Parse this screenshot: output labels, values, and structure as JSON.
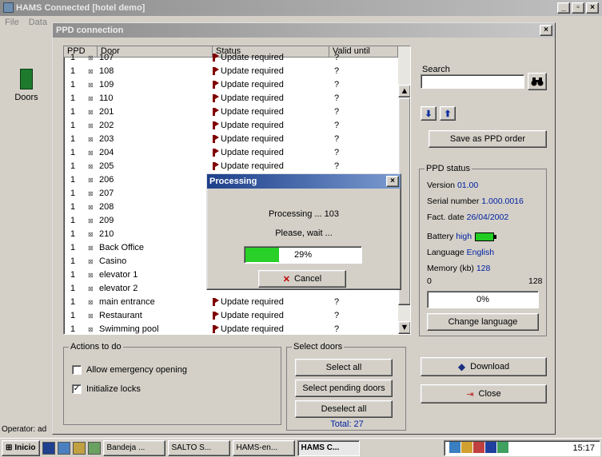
{
  "app": {
    "title": "HAMS Connected [hotel demo]",
    "menu": [
      "File",
      "Data"
    ],
    "left_tool_label": "Doors",
    "operator": "Operator: ad"
  },
  "dialog": {
    "title": "PPD connection",
    "close": "×"
  },
  "table": {
    "headers": [
      "PPD",
      "Door",
      "Status",
      "Valid until"
    ],
    "rows": [
      {
        "ppd": "1",
        "door": "107",
        "status": "Update required",
        "valid": "?"
      },
      {
        "ppd": "1",
        "door": "108",
        "status": "Update required",
        "valid": "?"
      },
      {
        "ppd": "1",
        "door": "109",
        "status": "Update required",
        "valid": "?"
      },
      {
        "ppd": "1",
        "door": "110",
        "status": "Update required",
        "valid": "?"
      },
      {
        "ppd": "1",
        "door": "201",
        "status": "Update required",
        "valid": "?"
      },
      {
        "ppd": "1",
        "door": "202",
        "status": "Update required",
        "valid": "?"
      },
      {
        "ppd": "1",
        "door": "203",
        "status": "Update required",
        "valid": "?"
      },
      {
        "ppd": "1",
        "door": "204",
        "status": "Update required",
        "valid": "?"
      },
      {
        "ppd": "1",
        "door": "205",
        "status": "Update required",
        "valid": "?"
      },
      {
        "ppd": "1",
        "door": "206",
        "status": "",
        "valid": ""
      },
      {
        "ppd": "1",
        "door": "207",
        "status": "",
        "valid": ""
      },
      {
        "ppd": "1",
        "door": "208",
        "status": "",
        "valid": ""
      },
      {
        "ppd": "1",
        "door": "209",
        "status": "",
        "valid": ""
      },
      {
        "ppd": "1",
        "door": "210",
        "status": "",
        "valid": ""
      },
      {
        "ppd": "1",
        "door": "Back Office",
        "status": "",
        "valid": ""
      },
      {
        "ppd": "1",
        "door": "Casino",
        "status": "",
        "valid": ""
      },
      {
        "ppd": "1",
        "door": "elevator 1",
        "status": "",
        "valid": ""
      },
      {
        "ppd": "1",
        "door": "elevator 2",
        "status": "",
        "valid": ""
      },
      {
        "ppd": "1",
        "door": "main entrance",
        "status": "Update required",
        "valid": "?"
      },
      {
        "ppd": "1",
        "door": "Restaurant",
        "status": "Update required",
        "valid": "?"
      },
      {
        "ppd": "1",
        "door": "Swimming pool",
        "status": "Update required",
        "valid": "?"
      }
    ]
  },
  "search": {
    "label": "Search",
    "value": "",
    "button_icon": "binoculars-icon"
  },
  "save_order_label": "Save as PPD order",
  "ppd_status": {
    "title": "PPD status",
    "version_label": "Version",
    "version": "01.00",
    "serial_label": "Serial number",
    "serial": "1.000.0016",
    "fact_label": "Fact. date",
    "fact_date": "26/04/2002",
    "battery_label": "Battery",
    "battery": "high",
    "language_label": "Language",
    "language": "English",
    "memory_label": "Memory (kb)",
    "memory": "128",
    "scale_min": "0",
    "scale_max": "128",
    "memory_used": "0%",
    "change_language_label": "Change language"
  },
  "actions": {
    "title": "Actions to do",
    "allow_emergency": "Allow emergency opening",
    "allow_emergency_checked": false,
    "initialize_locks": "Initialize locks",
    "initialize_locks_checked": true
  },
  "select_doors": {
    "title": "Select doors",
    "select_all": "Select all",
    "select_pending": "Select pending doors",
    "deselect_all": "Deselect all",
    "total": "Total: 27"
  },
  "download_label": "Download",
  "close_label": "Close",
  "processing": {
    "title": "Processing",
    "text1": "Processing ... 103",
    "text2": "Please, wait ...",
    "percent_text": "29%",
    "percent": 29,
    "cancel_label": "Cancel"
  },
  "taskbar": {
    "start_label": "Inicio",
    "tasks": [
      "Bandeja ...",
      "SALTO S...",
      "HAMS-en...",
      "HAMS C..."
    ],
    "clock": "15:17"
  }
}
